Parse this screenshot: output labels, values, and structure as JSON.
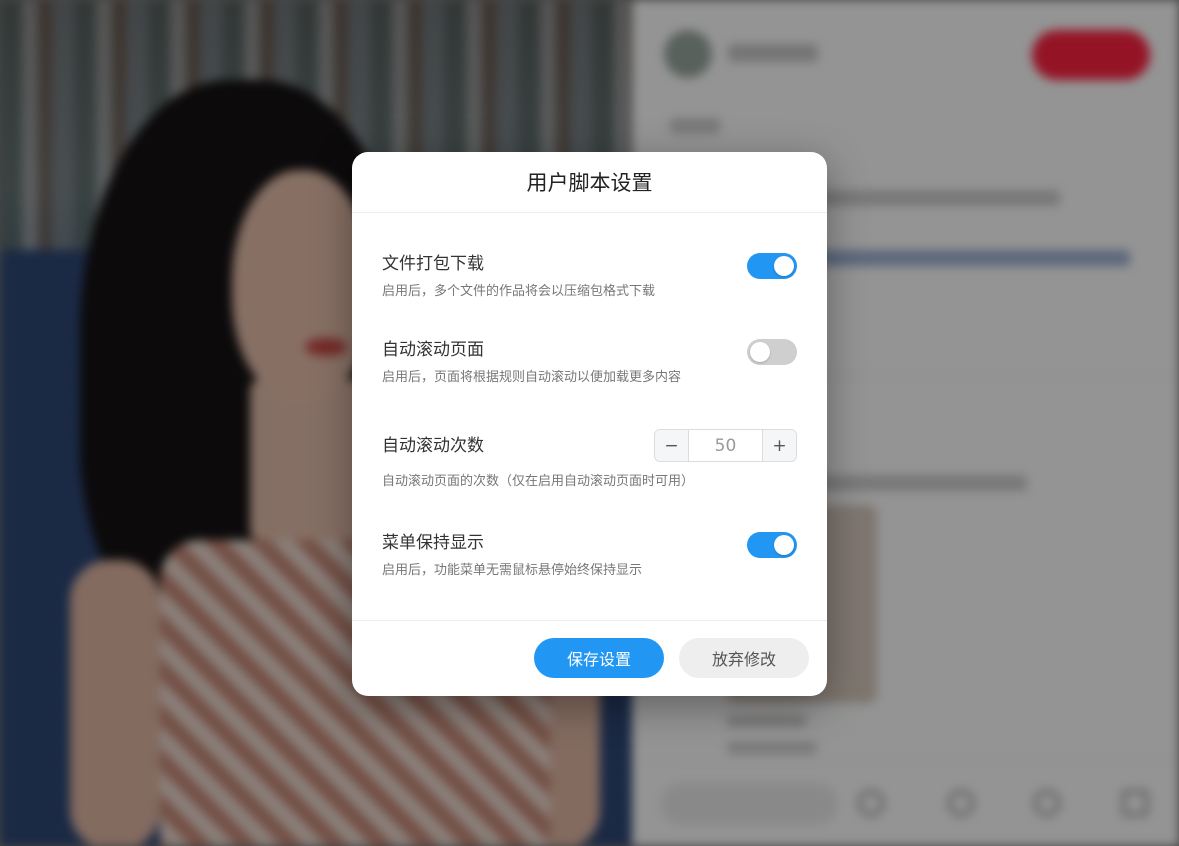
{
  "dialog": {
    "title": "用户脚本设置",
    "settings": [
      {
        "label": "文件打包下载",
        "description": "启用后，多个文件的作品将会以压缩包格式下载",
        "enabled": true
      },
      {
        "label": "自动滚动页面",
        "description": "启用后，页面将根据规则自动滚动以便加载更多内容",
        "enabled": false
      },
      {
        "label": "自动滚动次数",
        "description": "自动滚动页面的次数（仅在启用自动滚动页面时可用）",
        "value": "50",
        "minus": "−",
        "plus": "+"
      },
      {
        "label": "菜单保持显示",
        "description": "启用后，功能菜单无需鼠标悬停始终保持显示",
        "enabled": true
      }
    ],
    "save_label": "保存设置",
    "discard_label": "放弃修改"
  },
  "colors": {
    "accent": "#2196f3",
    "toggle_off": "#cfcfcf",
    "follow_button": "#ff2442"
  }
}
